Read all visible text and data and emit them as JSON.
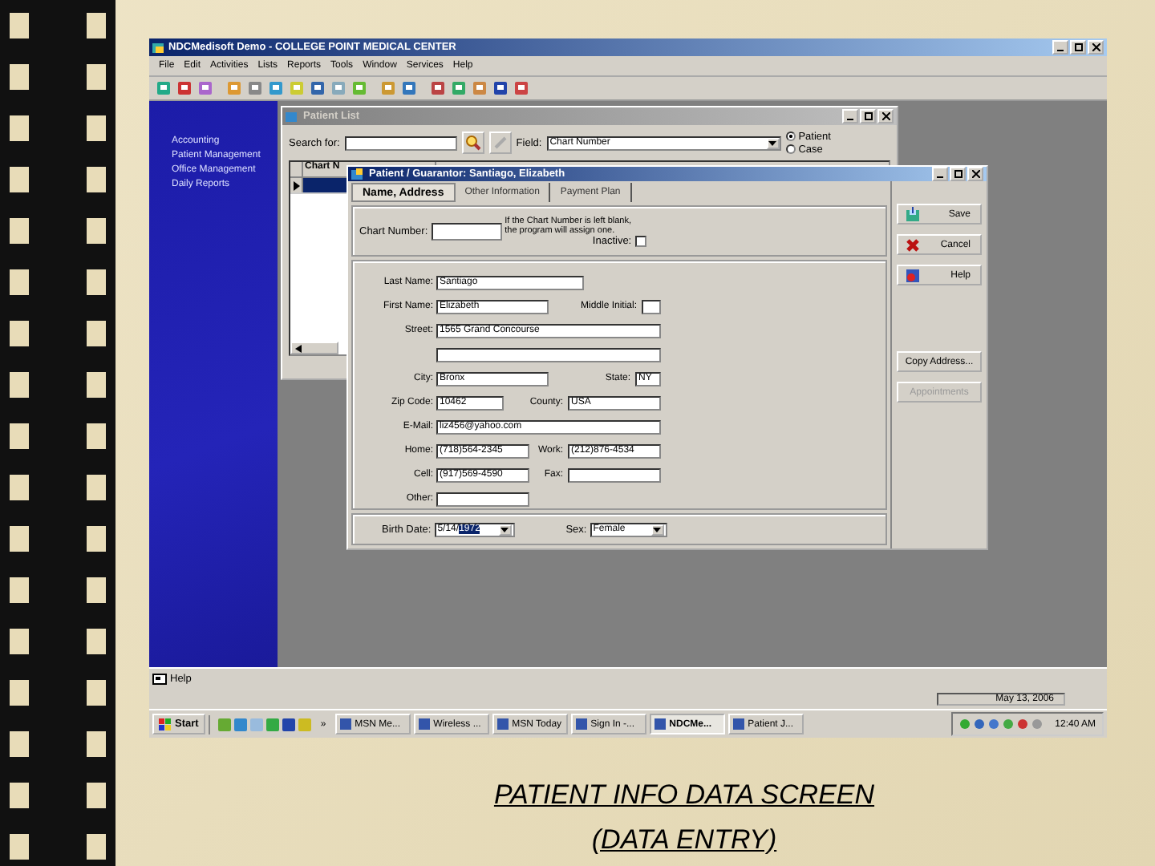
{
  "window": {
    "title": "NDCMedisoft Demo - COLLEGE POINT MEDICAL CENTER"
  },
  "menu": [
    "File",
    "Edit",
    "Activities",
    "Lists",
    "Reports",
    "Tools",
    "Window",
    "Services",
    "Help"
  ],
  "sidebar": {
    "items": [
      "Accounting",
      "Patient Management",
      "Office Management",
      "Daily Reports"
    ]
  },
  "patient_list": {
    "title": "Patient List",
    "search_label": "Search for:",
    "field_label": "Field:",
    "field_value": "Chart Number",
    "radios": [
      {
        "label": "Patient",
        "selected": true
      },
      {
        "label": "Case",
        "selected": false
      }
    ],
    "columns": [
      "Chart N"
    ],
    "rows": [
      {
        "selected": true
      }
    ]
  },
  "patient_dialog": {
    "title": "Patient / Guarantor: Santiago, Elizabeth",
    "tabs": [
      {
        "label": "Name, Address",
        "selected": true
      },
      {
        "label": "Other Information",
        "selected": false
      },
      {
        "label": "Payment Plan",
        "selected": false
      }
    ],
    "chart_number": {
      "label": "Chart Number:"
    },
    "note": "If the Chart Number is left blank, the program will assign one.",
    "inactive": {
      "label": "Inactive:",
      "checked": false
    },
    "rows": [
      [
        {
          "label": "Last Name:",
          "value": "Santiago",
          "kind": "name"
        }
      ],
      [
        {
          "label": "First Name:",
          "value": "Elizabeth",
          "kind": "medium"
        },
        {
          "label": "Middle Initial:",
          "kind": "tiny"
        }
      ],
      [
        {
          "label": "Street:",
          "value": "1565 Grand Concourse",
          "kind": "long"
        }
      ],
      [
        {
          "kind": "long"
        }
      ],
      [
        {
          "label": "City:",
          "value": "Bronx",
          "kind": "medium"
        },
        {
          "label": "State:",
          "value": "NY",
          "kind": "state"
        }
      ],
      [
        {
          "label": "Zip Code:",
          "value": "10462",
          "kind": "short"
        },
        {
          "label": "County:",
          "value": "USA",
          "kind": "right"
        }
      ],
      [
        {
          "label": "E-Mail:",
          "value": "liz456@yahoo.com",
          "kind": "long"
        }
      ],
      [
        {
          "label": "Home:",
          "value": "(718)564-2345",
          "kind": "phone"
        },
        {
          "label": "Work:",
          "value": "(212)876-4534",
          "kind": "right"
        }
      ],
      [
        {
          "label": "Cell:",
          "value": "(917)569-4590",
          "kind": "phone"
        },
        {
          "label": "Fax:",
          "kind": "right"
        }
      ],
      [
        {
          "label": "Other:",
          "kind": "phone"
        }
      ]
    ],
    "birth_date": {
      "label": "Birth Date:",
      "value": "5/14/",
      "selection": "1972"
    },
    "sex": {
      "label": "Sex:",
      "value": "Female"
    },
    "buttons": [
      {
        "label": "Save",
        "kind": "save",
        "disabled": false
      },
      {
        "label": "Cancel",
        "kind": "cancel",
        "disabled": false
      },
      {
        "label": "Help",
        "kind": "help",
        "disabled": false
      },
      {
        "label": "Copy Address...",
        "kind": "plain",
        "disabled": false
      },
      {
        "label": "Appointments",
        "kind": "plain",
        "disabled": true
      }
    ]
  },
  "status_bar": {
    "help": "Help",
    "date": "May 13, 2006"
  },
  "taskbar": {
    "start": "Start",
    "chevron": "»",
    "tasks": [
      {
        "label": "MSN Me...",
        "selected": false
      },
      {
        "label": "Wireless ...",
        "selected": false
      },
      {
        "label": "MSN Today",
        "selected": false
      },
      {
        "label": "Sign In -...",
        "selected": false
      },
      {
        "label": "NDCMe...",
        "selected": true
      },
      {
        "label": "Patient J...",
        "selected": false
      }
    ],
    "clock": "12:40 AM"
  },
  "caption": [
    "PATIENT INFO DATA SCREEN",
    "(DATA ENTRY)"
  ]
}
